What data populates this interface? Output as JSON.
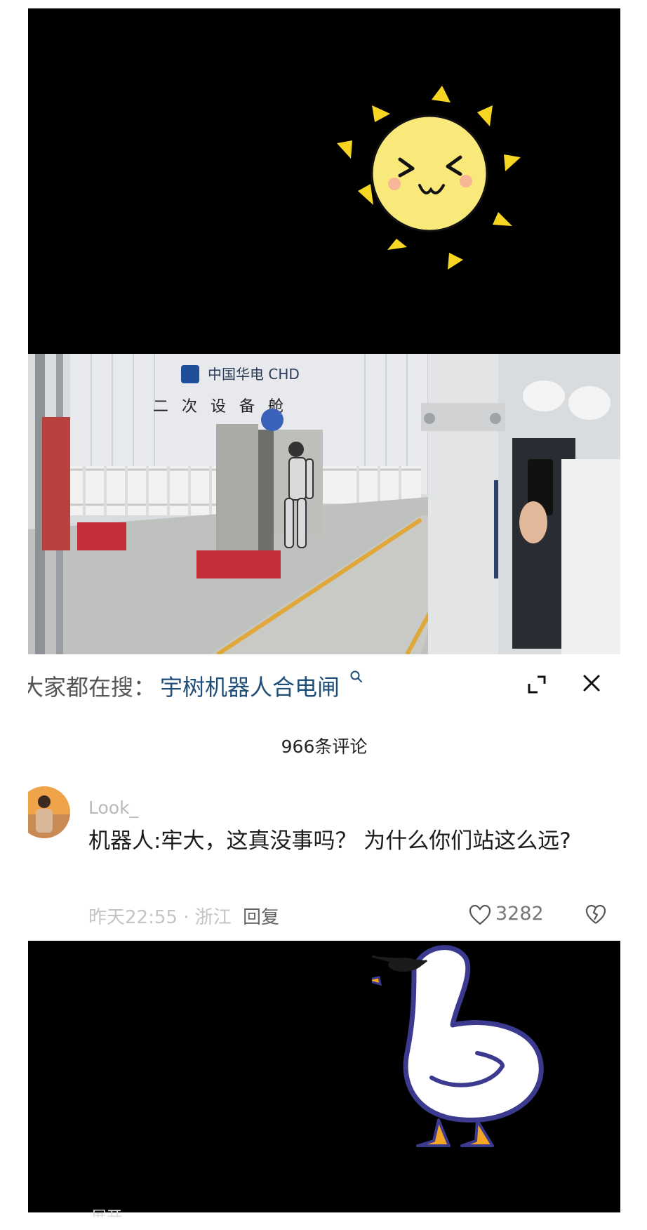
{
  "video_overlay": {
    "brand_text": "中国华电 CHD",
    "building_label": "二 次 设 备 舱"
  },
  "search_bar": {
    "prefix": "大家都在搜：",
    "term": "宇树机器人合电闸"
  },
  "comments": {
    "count_label": "966条评论"
  },
  "comment": {
    "username": "Look_",
    "text": "机器人:牢大，这真没事吗？ 为什么你们站这么远?",
    "time": "昨天22:55",
    "location": "浙江",
    "reply_label": "回复",
    "like_count": "3282"
  },
  "bottom": {
    "peek_text": "展开"
  },
  "colors": {
    "sun_yellow": "#f9e97b",
    "ray_yellow": "#f6d623",
    "search_term_blue": "#1f4e79",
    "duck_outline": "#3b3a8f",
    "duck_beak": "#f5a623"
  }
}
